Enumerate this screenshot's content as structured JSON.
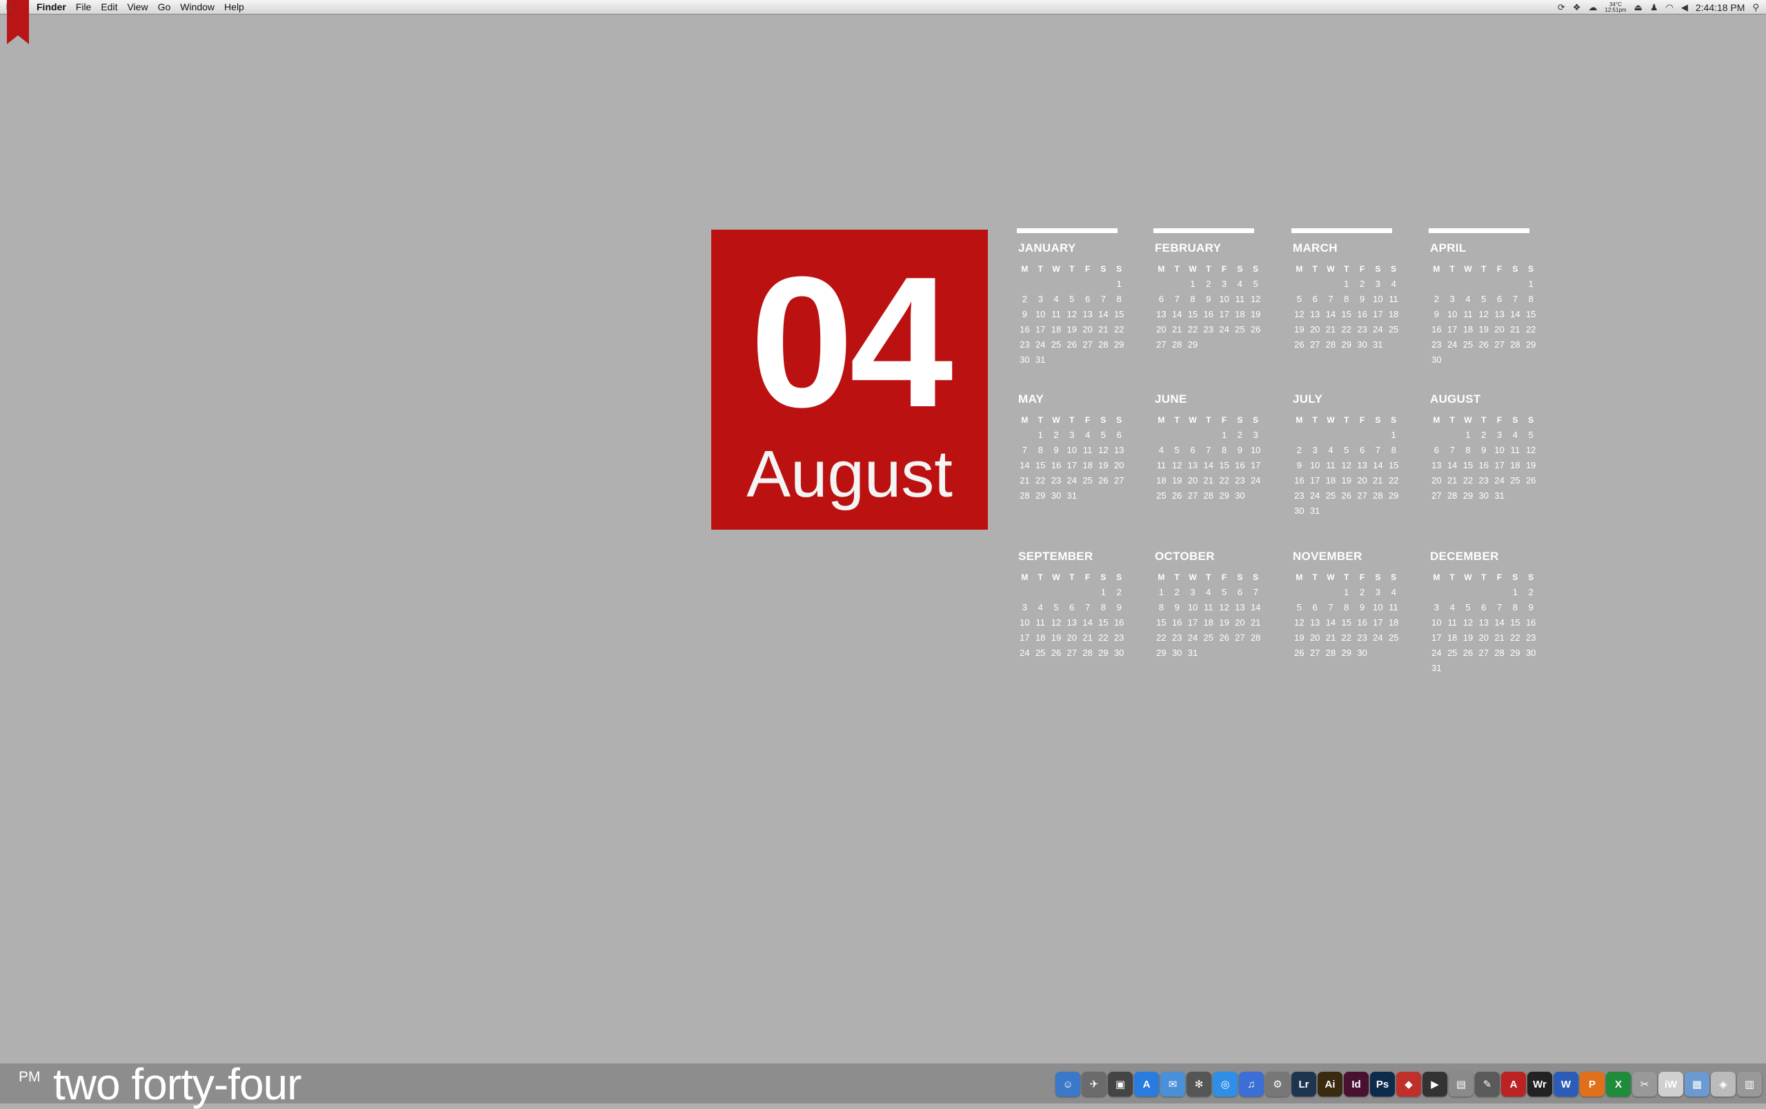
{
  "menubar": {
    "apple": "",
    "items": [
      "Finder",
      "File",
      "Edit",
      "View",
      "Go",
      "Window",
      "Help"
    ],
    "status": {
      "temp": "34°C",
      "temp_sub": "12:51pm",
      "clock": "2:44:18 PM"
    }
  },
  "date_block": {
    "day": "04",
    "month": "August",
    "color": "#bb1111"
  },
  "calendar": {
    "weekday_headers": [
      "M",
      "T",
      "W",
      "T",
      "F",
      "S",
      "S"
    ],
    "months": [
      {
        "name": "JANUARY",
        "start": 7,
        "days": 31
      },
      {
        "name": "FEBRUARY",
        "start": 3,
        "days": 29
      },
      {
        "name": "MARCH",
        "start": 4,
        "days": 31
      },
      {
        "name": "APRIL",
        "start": 7,
        "days": 30
      },
      {
        "name": "MAY",
        "start": 2,
        "days": 31
      },
      {
        "name": "JUNE",
        "start": 5,
        "days": 30
      },
      {
        "name": "JULY",
        "start": 7,
        "days": 31
      },
      {
        "name": "AUGUST",
        "start": 3,
        "days": 31
      },
      {
        "name": "SEPTEMBER",
        "start": 6,
        "days": 30
      },
      {
        "name": "OCTOBER",
        "start": 1,
        "days": 31
      },
      {
        "name": "NOVEMBER",
        "start": 4,
        "days": 30
      },
      {
        "name": "DECEMBER",
        "start": 6,
        "days": 31
      }
    ]
  },
  "bottombar": {
    "meridiem": "PM",
    "time_words": "two forty-four"
  },
  "dock": [
    {
      "icon": "finder-icon",
      "glyph": "☺",
      "color": "#3a78c9"
    },
    {
      "icon": "rocket-icon",
      "glyph": "✈",
      "color": "#6b6b6b"
    },
    {
      "icon": "photobooth-icon",
      "glyph": "▣",
      "color": "#444"
    },
    {
      "icon": "appstore-icon",
      "glyph": "A",
      "color": "#2a7be0"
    },
    {
      "icon": "mail-icon",
      "glyph": "✉",
      "color": "#4a90d9"
    },
    {
      "icon": "dashboard-icon",
      "glyph": "✻",
      "color": "#555"
    },
    {
      "icon": "safari-icon",
      "glyph": "◎",
      "color": "#2f8ee8"
    },
    {
      "icon": "itunes-icon",
      "glyph": "♫",
      "color": "#3b6fd6"
    },
    {
      "icon": "preferences-icon",
      "glyph": "⚙",
      "color": "#777"
    },
    {
      "icon": "lightroom-icon",
      "glyph": "Lr",
      "color": "#1e3550"
    },
    {
      "icon": "illustrator-icon",
      "glyph": "Ai",
      "color": "#3a2a10"
    },
    {
      "icon": "indesign-icon",
      "glyph": "Id",
      "color": "#4a1030"
    },
    {
      "icon": "photoshop-icon",
      "glyph": "Ps",
      "color": "#0d2b4a"
    },
    {
      "icon": "app-red-icon",
      "glyph": "◆",
      "color": "#c0302a"
    },
    {
      "icon": "finalcut-icon",
      "glyph": "▶",
      "color": "#333"
    },
    {
      "icon": "preview-icon",
      "glyph": "▤",
      "color": "#8a8a8a"
    },
    {
      "icon": "feather-icon",
      "glyph": "✎",
      "color": "#5a5a5a"
    },
    {
      "icon": "acrobat-icon",
      "glyph": "A",
      "color": "#b22"
    },
    {
      "icon": "wordpress-icon",
      "glyph": "Wr",
      "color": "#222"
    },
    {
      "icon": "word-icon",
      "glyph": "W",
      "color": "#2b5db8"
    },
    {
      "icon": "pages-icon",
      "glyph": "P",
      "color": "#e0701c"
    },
    {
      "icon": "excel-icon",
      "glyph": "X",
      "color": "#1e8c3a"
    },
    {
      "icon": "scissors-icon",
      "glyph": "✂",
      "color": "#999"
    },
    {
      "icon": "iwork-icon",
      "glyph": "iW",
      "color": "#d0d0d0"
    },
    {
      "icon": "documents-icon",
      "glyph": "▦",
      "color": "#6a9ad0"
    },
    {
      "icon": "downloads-icon",
      "glyph": "◈",
      "color": "#bbb"
    },
    {
      "icon": "trash-icon",
      "glyph": "▥",
      "color": "#999"
    }
  ]
}
